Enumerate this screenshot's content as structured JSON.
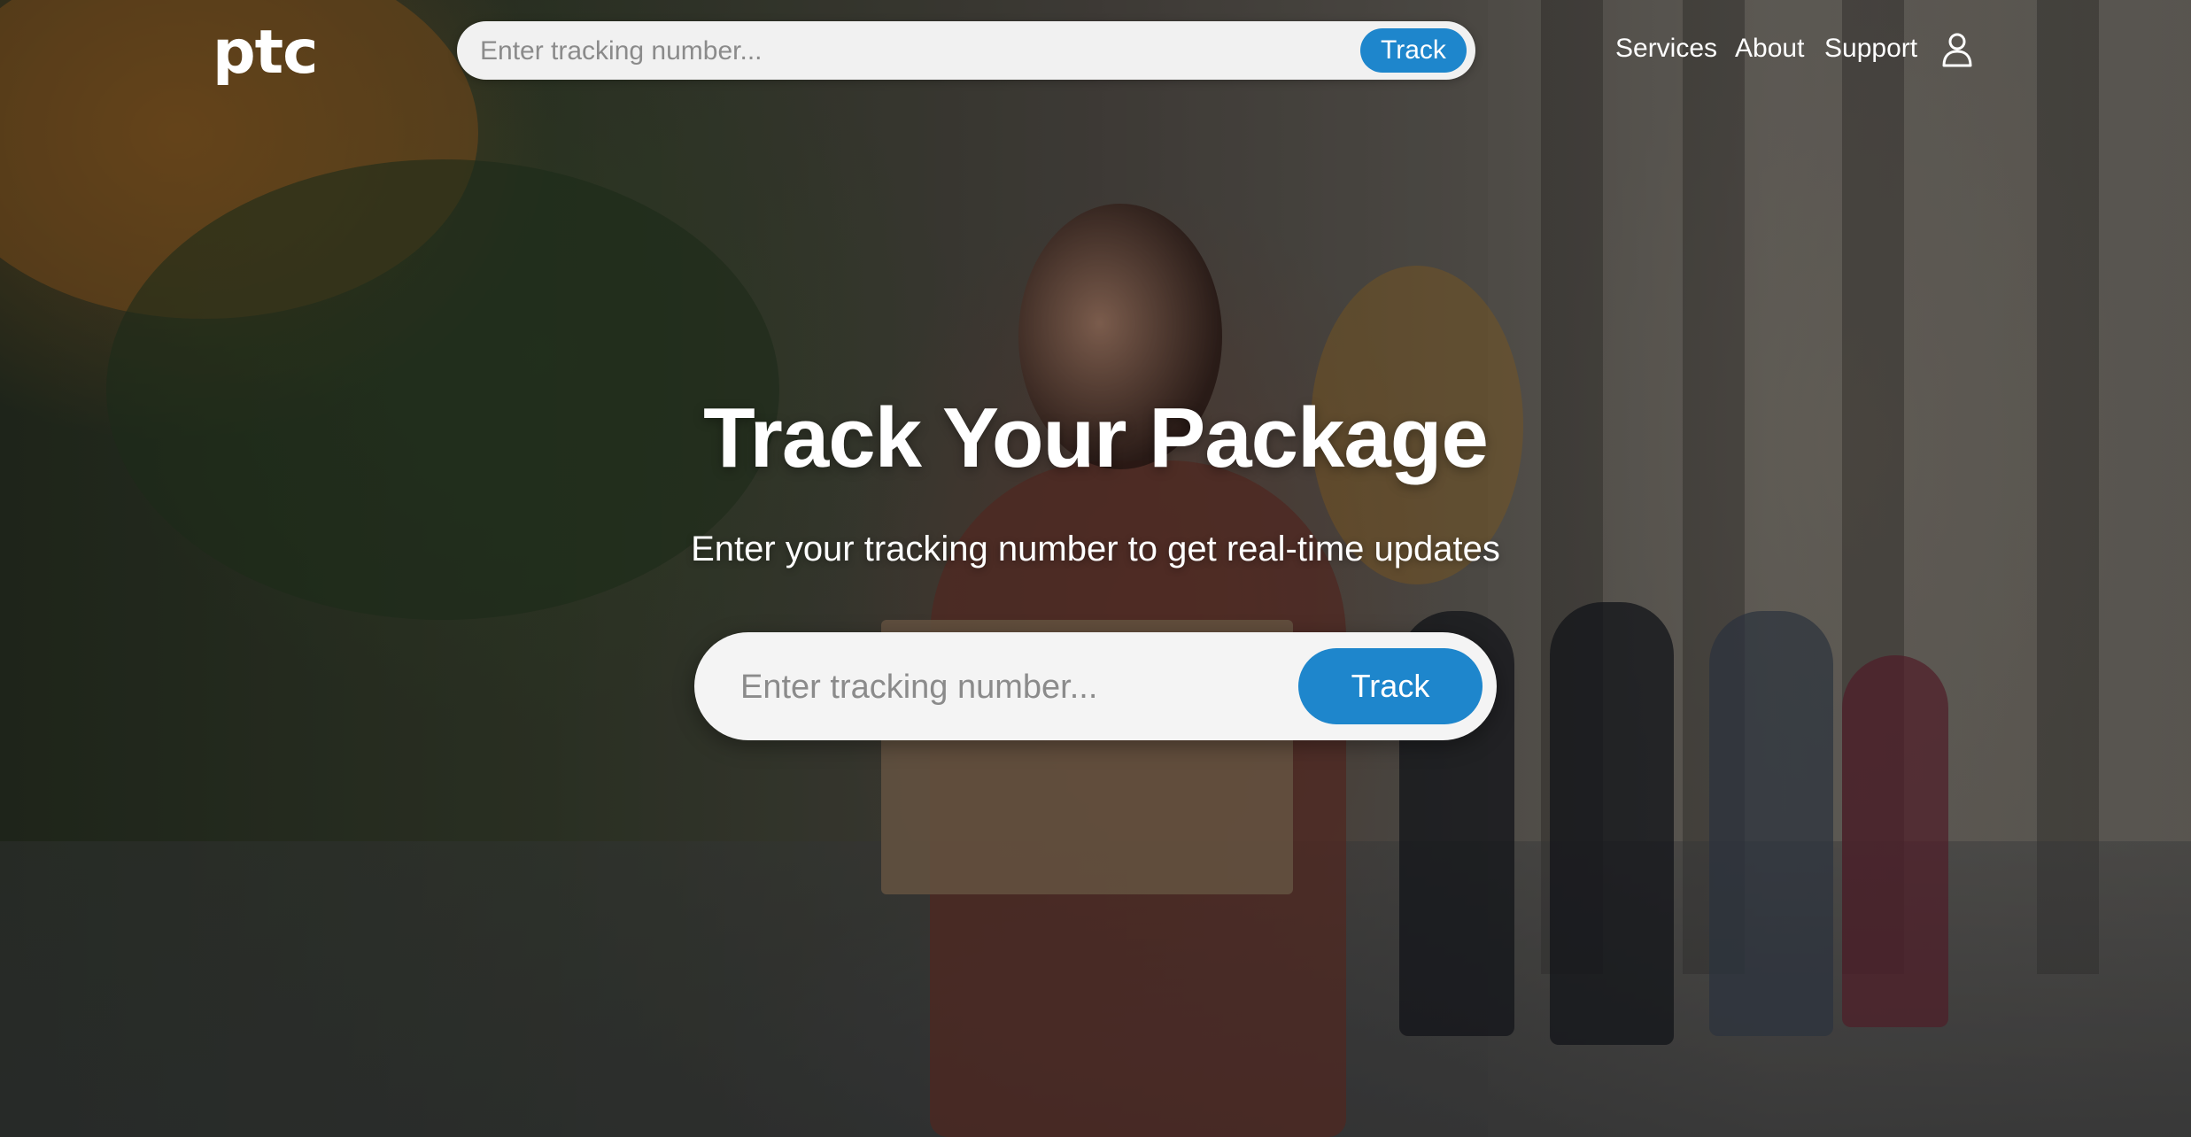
{
  "header": {
    "logo": "ptc",
    "search": {
      "placeholder": "Enter tracking number...",
      "button_label": "Track"
    },
    "nav": [
      {
        "label": "Services"
      },
      {
        "label": "About"
      },
      {
        "label": "Support"
      }
    ],
    "user_icon": "user-icon"
  },
  "hero": {
    "title": "Track Your Package",
    "subtitle": "Enter your tracking number to get real-time updates",
    "search": {
      "placeholder": "Enter tracking number...",
      "button_label": "Track"
    },
    "background_image": "woman-carrying-package-on-city-sidewalk"
  },
  "colors": {
    "accent": "#1e86cc",
    "text_light": "#ffffff",
    "input_bg": "#f1f1f1"
  }
}
